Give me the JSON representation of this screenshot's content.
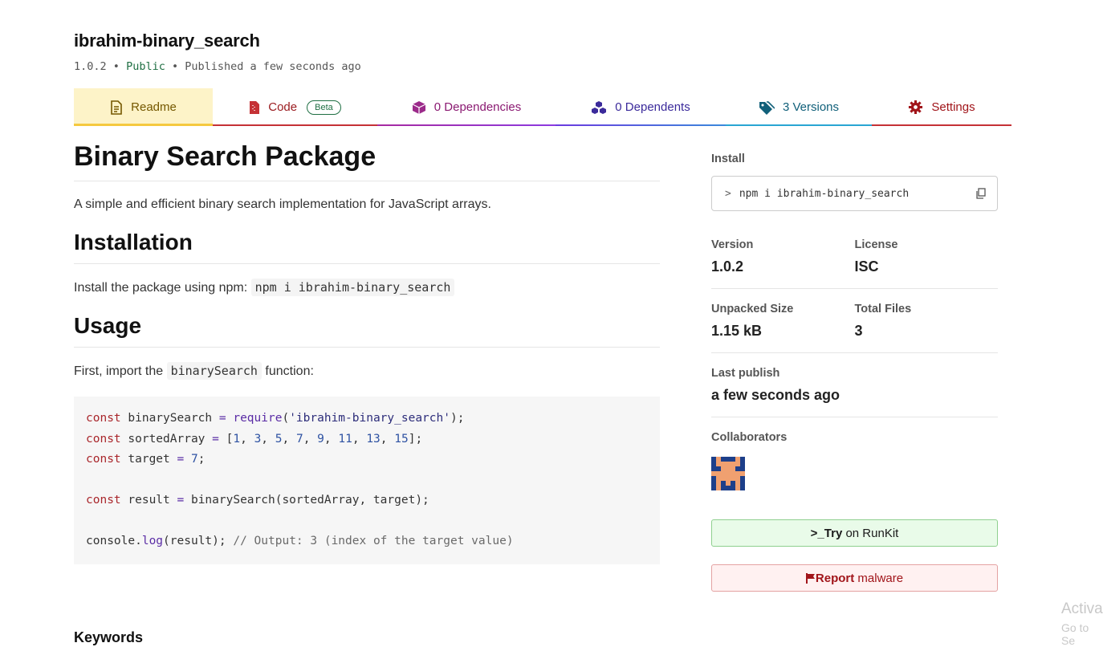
{
  "package": {
    "name": "ibrahim-binary_search",
    "version": "1.0.2",
    "visibility": "Public",
    "published": "Published a few seconds ago",
    "separator": "•"
  },
  "tabs": [
    {
      "label": "Readme",
      "icon": "document-icon"
    },
    {
      "label": "Code",
      "badge": "Beta",
      "icon": "code-file-icon"
    },
    {
      "label": "0 Dependencies",
      "icon": "box-icon"
    },
    {
      "label": "0 Dependents",
      "icon": "boxes-icon"
    },
    {
      "label": "3 Versions",
      "icon": "tags-icon"
    },
    {
      "label": "Settings",
      "icon": "gear-icon"
    }
  ],
  "readme": {
    "title": "Binary Search Package",
    "intro": "A simple and efficient binary search implementation for JavaScript arrays.",
    "installation_heading": "Installation",
    "install_text": "Install the package using npm:",
    "install_code": "npm i ibrahim-binary_search",
    "usage_heading": "Usage",
    "usage_text_before": "First, import the",
    "usage_code": "binarySearch",
    "usage_text_after": "function:",
    "code_lines": [
      "const binarySearch = require('ibrahim-binary_search');",
      "const sortedArray = [1, 3, 5, 7, 9, 11, 13, 15];",
      "const target = 7;",
      "",
      "const result = binarySearch(sortedArray, target);",
      "",
      "console.log(result); // Output: 3 (index of the target value)"
    ],
    "keywords_heading": "Keywords"
  },
  "sidebar": {
    "install_label": "Install",
    "install_prompt": ">",
    "install_cmd": "npm i ibrahim-binary_search",
    "version_label": "Version",
    "version_value": "1.0.2",
    "license_label": "License",
    "license_value": "ISC",
    "unpacked_label": "Unpacked Size",
    "unpacked_value": "1.15 kB",
    "files_label": "Total Files",
    "files_value": "3",
    "last_publish_label": "Last publish",
    "last_publish_value": "a few seconds ago",
    "collaborators_label": "Collaborators",
    "runkit_prefix": ">_",
    "runkit_bold": "Try",
    "runkit_rest": "on RunKit",
    "report_bold": "Report",
    "report_rest": "malware"
  },
  "watermark": {
    "line1": "Activa",
    "line2": "Go to Se"
  },
  "colors": {
    "readme_tab_bg": "#fdf3c8",
    "readme_tab_border": "#f5c93f",
    "code_tab": "#c53236",
    "runkit_bg": "#e9fbe9",
    "report_bg": "#fff1f1"
  }
}
